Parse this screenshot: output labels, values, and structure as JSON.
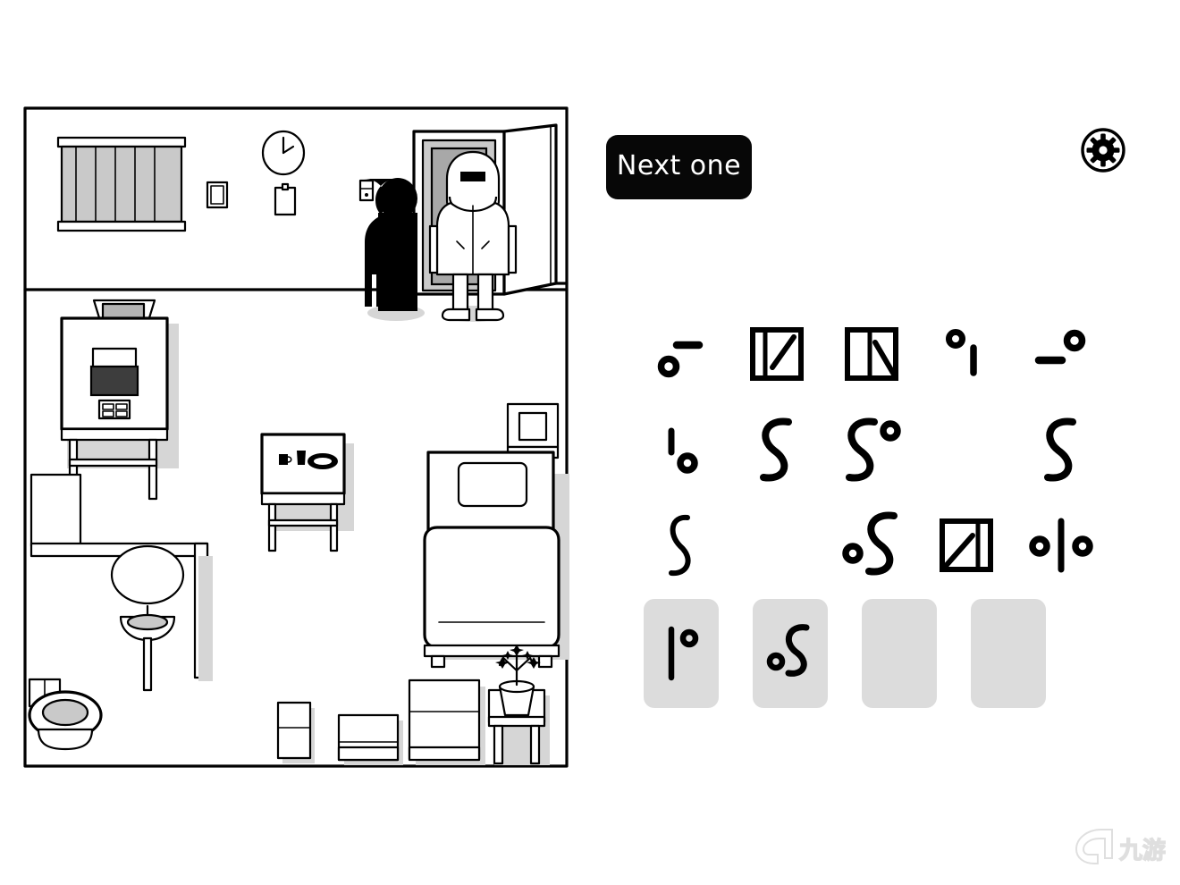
{
  "app": {
    "title": "Quarantine Room Symbol Puzzle",
    "background_color": "#ffffff",
    "ink_color": "#000000",
    "slot_fill_color": "#dcdcdc",
    "shadow_color": "#d4d4d4"
  },
  "toolbar": {
    "next_label": "Next one",
    "settings_icon": "gear-icon"
  },
  "scene": {
    "name": "isolation-room",
    "description": "Top-down black-and-white drawing of a quarantine hospital room",
    "wall_items": [
      {
        "name": "barred-window",
        "label": "Barred window"
      },
      {
        "name": "wall-clock",
        "label": "Wall clock"
      },
      {
        "name": "picture-frame",
        "label": "Small framed picture"
      },
      {
        "name": "clipboard",
        "label": "Clipboard"
      },
      {
        "name": "light-switch",
        "label": "Light switch"
      },
      {
        "name": "door",
        "label": "Open door"
      }
    ],
    "characters": [
      {
        "name": "silhouette-person",
        "label": "Dark silhouette figure"
      },
      {
        "name": "hazmat-person",
        "label": "Person in hazmat suit"
      }
    ],
    "furniture": [
      {
        "name": "equipment-desk",
        "label": "Desk with monitor and chair"
      },
      {
        "name": "dining-table",
        "label": "Table with cup, glass and plate"
      },
      {
        "name": "bed",
        "label": "Bed with pillow"
      },
      {
        "name": "nightstand",
        "label": "Nightstand"
      },
      {
        "name": "bathroom-sink",
        "label": "Sink with mirror"
      },
      {
        "name": "toilet",
        "label": "Toilet"
      },
      {
        "name": "cabinet-small",
        "label": "Small cabinet"
      },
      {
        "name": "cabinet-wide",
        "label": "Wide cabinet"
      },
      {
        "name": "cabinet-large",
        "label": "Large cabinet"
      },
      {
        "name": "plant-stand",
        "label": "Plant on stand"
      }
    ]
  },
  "puzzle": {
    "grid": {
      "rows": 3,
      "columns": 5,
      "cells": [
        {
          "position": "r1c1",
          "glyph": "circle-dash",
          "label": "Circle with dash above right",
          "empty": false
        },
        {
          "position": "r1c2",
          "glyph": "box-left-bar-diagonal-up",
          "label": "Square with left bar and upward diagonal",
          "empty": false
        },
        {
          "position": "r1c3",
          "glyph": "box-center-bar-diagonal-down",
          "label": "Square with center bar and downward diagonal",
          "empty": false
        },
        {
          "position": "r1c4",
          "glyph": "circle-vertical-bar",
          "label": "Small circle above vertical bar",
          "empty": false
        },
        {
          "position": "r1c5",
          "glyph": "dash-circle",
          "label": "Dash with circle above right",
          "empty": false
        },
        {
          "position": "r2c1",
          "glyph": "bar-circle",
          "label": "Vertical bar with circle below right",
          "empty": false
        },
        {
          "position": "r2c2",
          "glyph": "s-curve",
          "label": "S curve",
          "empty": false
        },
        {
          "position": "r2c3",
          "glyph": "s-curve-circle",
          "label": "S curve with circle at top right",
          "empty": false
        },
        {
          "position": "r2c4",
          "glyph": "",
          "label": "Empty cell",
          "empty": true
        },
        {
          "position": "r2c5",
          "glyph": "s-curve",
          "label": "S curve",
          "empty": false
        },
        {
          "position": "r3c1",
          "glyph": "s-curve-thin",
          "label": "Thin S curve",
          "empty": false
        },
        {
          "position": "r3c2",
          "glyph": "",
          "label": "Empty cell",
          "empty": true
        },
        {
          "position": "r3c3",
          "glyph": "circle-s-curve",
          "label": "Circle at lower left with S curve",
          "empty": false
        },
        {
          "position": "r3c4",
          "glyph": "box-right-bar-diagonal-up",
          "label": "Square with right bar and upward diagonal",
          "empty": false
        },
        {
          "position": "r3c5",
          "glyph": "circle-bar-circle",
          "label": "Circle, vertical bar, circle",
          "empty": false
        }
      ]
    },
    "answer_slots": [
      {
        "index": 1,
        "glyph": "bar-circle-top",
        "label": "Vertical bar with circle at top right",
        "filled": true
      },
      {
        "index": 2,
        "glyph": "circle-s-curve",
        "label": "Circle at lower left with S curve",
        "filled": true
      },
      {
        "index": 3,
        "glyph": "",
        "label": "Empty answer slot",
        "filled": false
      },
      {
        "index": 4,
        "glyph": "",
        "label": "Empty answer slot",
        "filled": false
      }
    ]
  },
  "watermark": {
    "text": "九游",
    "label": "Jiuyou watermark"
  }
}
